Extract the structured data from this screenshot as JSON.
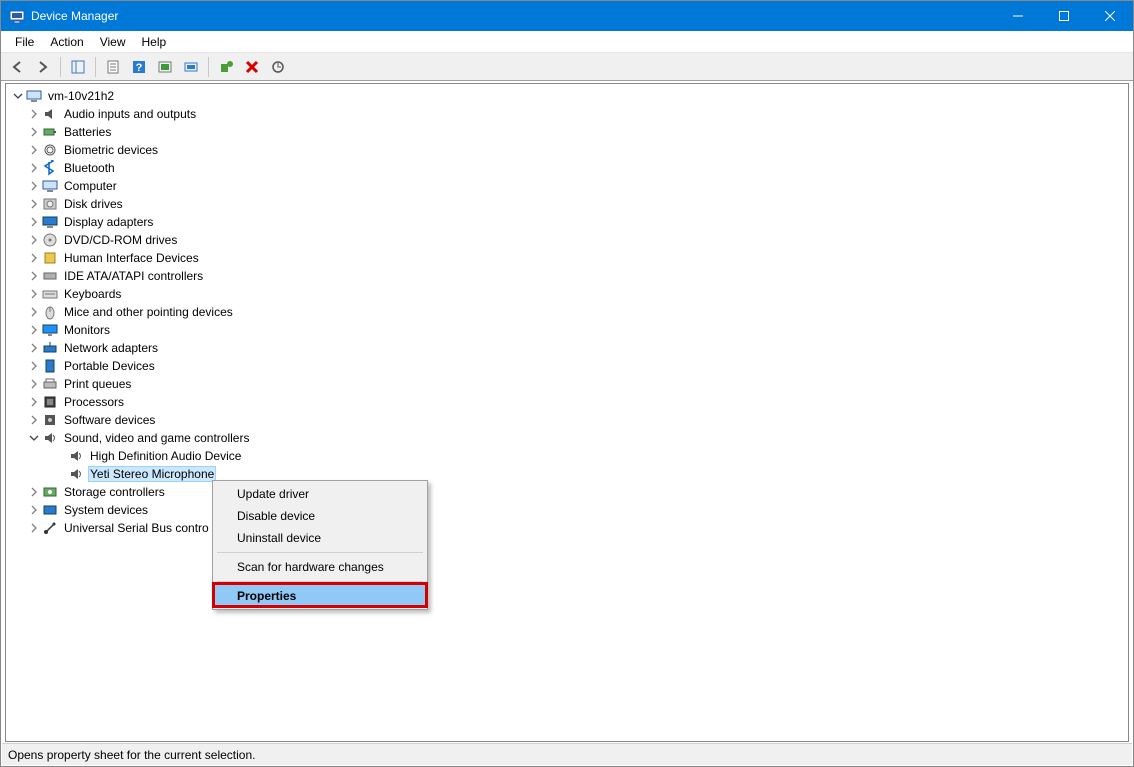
{
  "window": {
    "title": "Device Manager"
  },
  "menu": {
    "items": [
      "File",
      "Action",
      "View",
      "Help"
    ]
  },
  "toolbar": {
    "buttons": [
      {
        "name": "back-icon"
      },
      {
        "name": "forward-icon"
      },
      {
        "name": "show-hide-tree-icon"
      },
      {
        "name": "properties-icon"
      },
      {
        "name": "help-icon"
      },
      {
        "name": "refresh-icon"
      },
      {
        "name": "monitor-icon"
      },
      {
        "name": "add-hardware-icon"
      },
      {
        "name": "remove-icon"
      },
      {
        "name": "scan-icon"
      }
    ]
  },
  "tree": {
    "root": {
      "label": "vm-10v21h2",
      "icon": "computer-icon",
      "expanded": true
    },
    "categories": [
      {
        "label": "Audio inputs and outputs",
        "icon": "speaker-icon"
      },
      {
        "label": "Batteries",
        "icon": "battery-icon"
      },
      {
        "label": "Biometric devices",
        "icon": "fingerprint-icon"
      },
      {
        "label": "Bluetooth",
        "icon": "bluetooth-icon"
      },
      {
        "label": "Computer",
        "icon": "computer-icon"
      },
      {
        "label": "Disk drives",
        "icon": "disk-icon"
      },
      {
        "label": "Display adapters",
        "icon": "display-icon"
      },
      {
        "label": "DVD/CD-ROM drives",
        "icon": "optical-icon"
      },
      {
        "label": "Human Interface Devices",
        "icon": "hid-icon"
      },
      {
        "label": "IDE ATA/ATAPI controllers",
        "icon": "ide-icon"
      },
      {
        "label": "Keyboards",
        "icon": "keyboard-icon"
      },
      {
        "label": "Mice and other pointing devices",
        "icon": "mouse-icon"
      },
      {
        "label": "Monitors",
        "icon": "monitor-icon"
      },
      {
        "label": "Network adapters",
        "icon": "network-icon"
      },
      {
        "label": "Portable Devices",
        "icon": "portable-icon"
      },
      {
        "label": "Print queues",
        "icon": "printer-icon"
      },
      {
        "label": "Processors",
        "icon": "cpu-icon"
      },
      {
        "label": "Software devices",
        "icon": "software-icon"
      },
      {
        "label": "Sound, video and game controllers",
        "icon": "sound-icon",
        "expanded": true,
        "children": [
          {
            "label": "High Definition Audio Device",
            "icon": "sound-icon"
          },
          {
            "label": "Yeti Stereo Microphone",
            "icon": "sound-icon",
            "selected": true
          }
        ]
      },
      {
        "label": "Storage controllers",
        "icon": "storage-icon"
      },
      {
        "label": "System devices",
        "icon": "system-icon"
      },
      {
        "label": "Universal Serial Bus controllers",
        "icon": "usb-icon",
        "truncated": "Universal Serial Bus contro"
      }
    ]
  },
  "context_menu": {
    "items": [
      {
        "label": "Update driver"
      },
      {
        "label": "Disable device"
      },
      {
        "label": "Uninstall device"
      },
      {
        "separator": true
      },
      {
        "label": "Scan for hardware changes"
      },
      {
        "separator": true
      },
      {
        "label": "Properties",
        "hover": true,
        "highlighted": true
      }
    ]
  },
  "statusbar": {
    "text": "Opens property sheet for the current selection."
  }
}
